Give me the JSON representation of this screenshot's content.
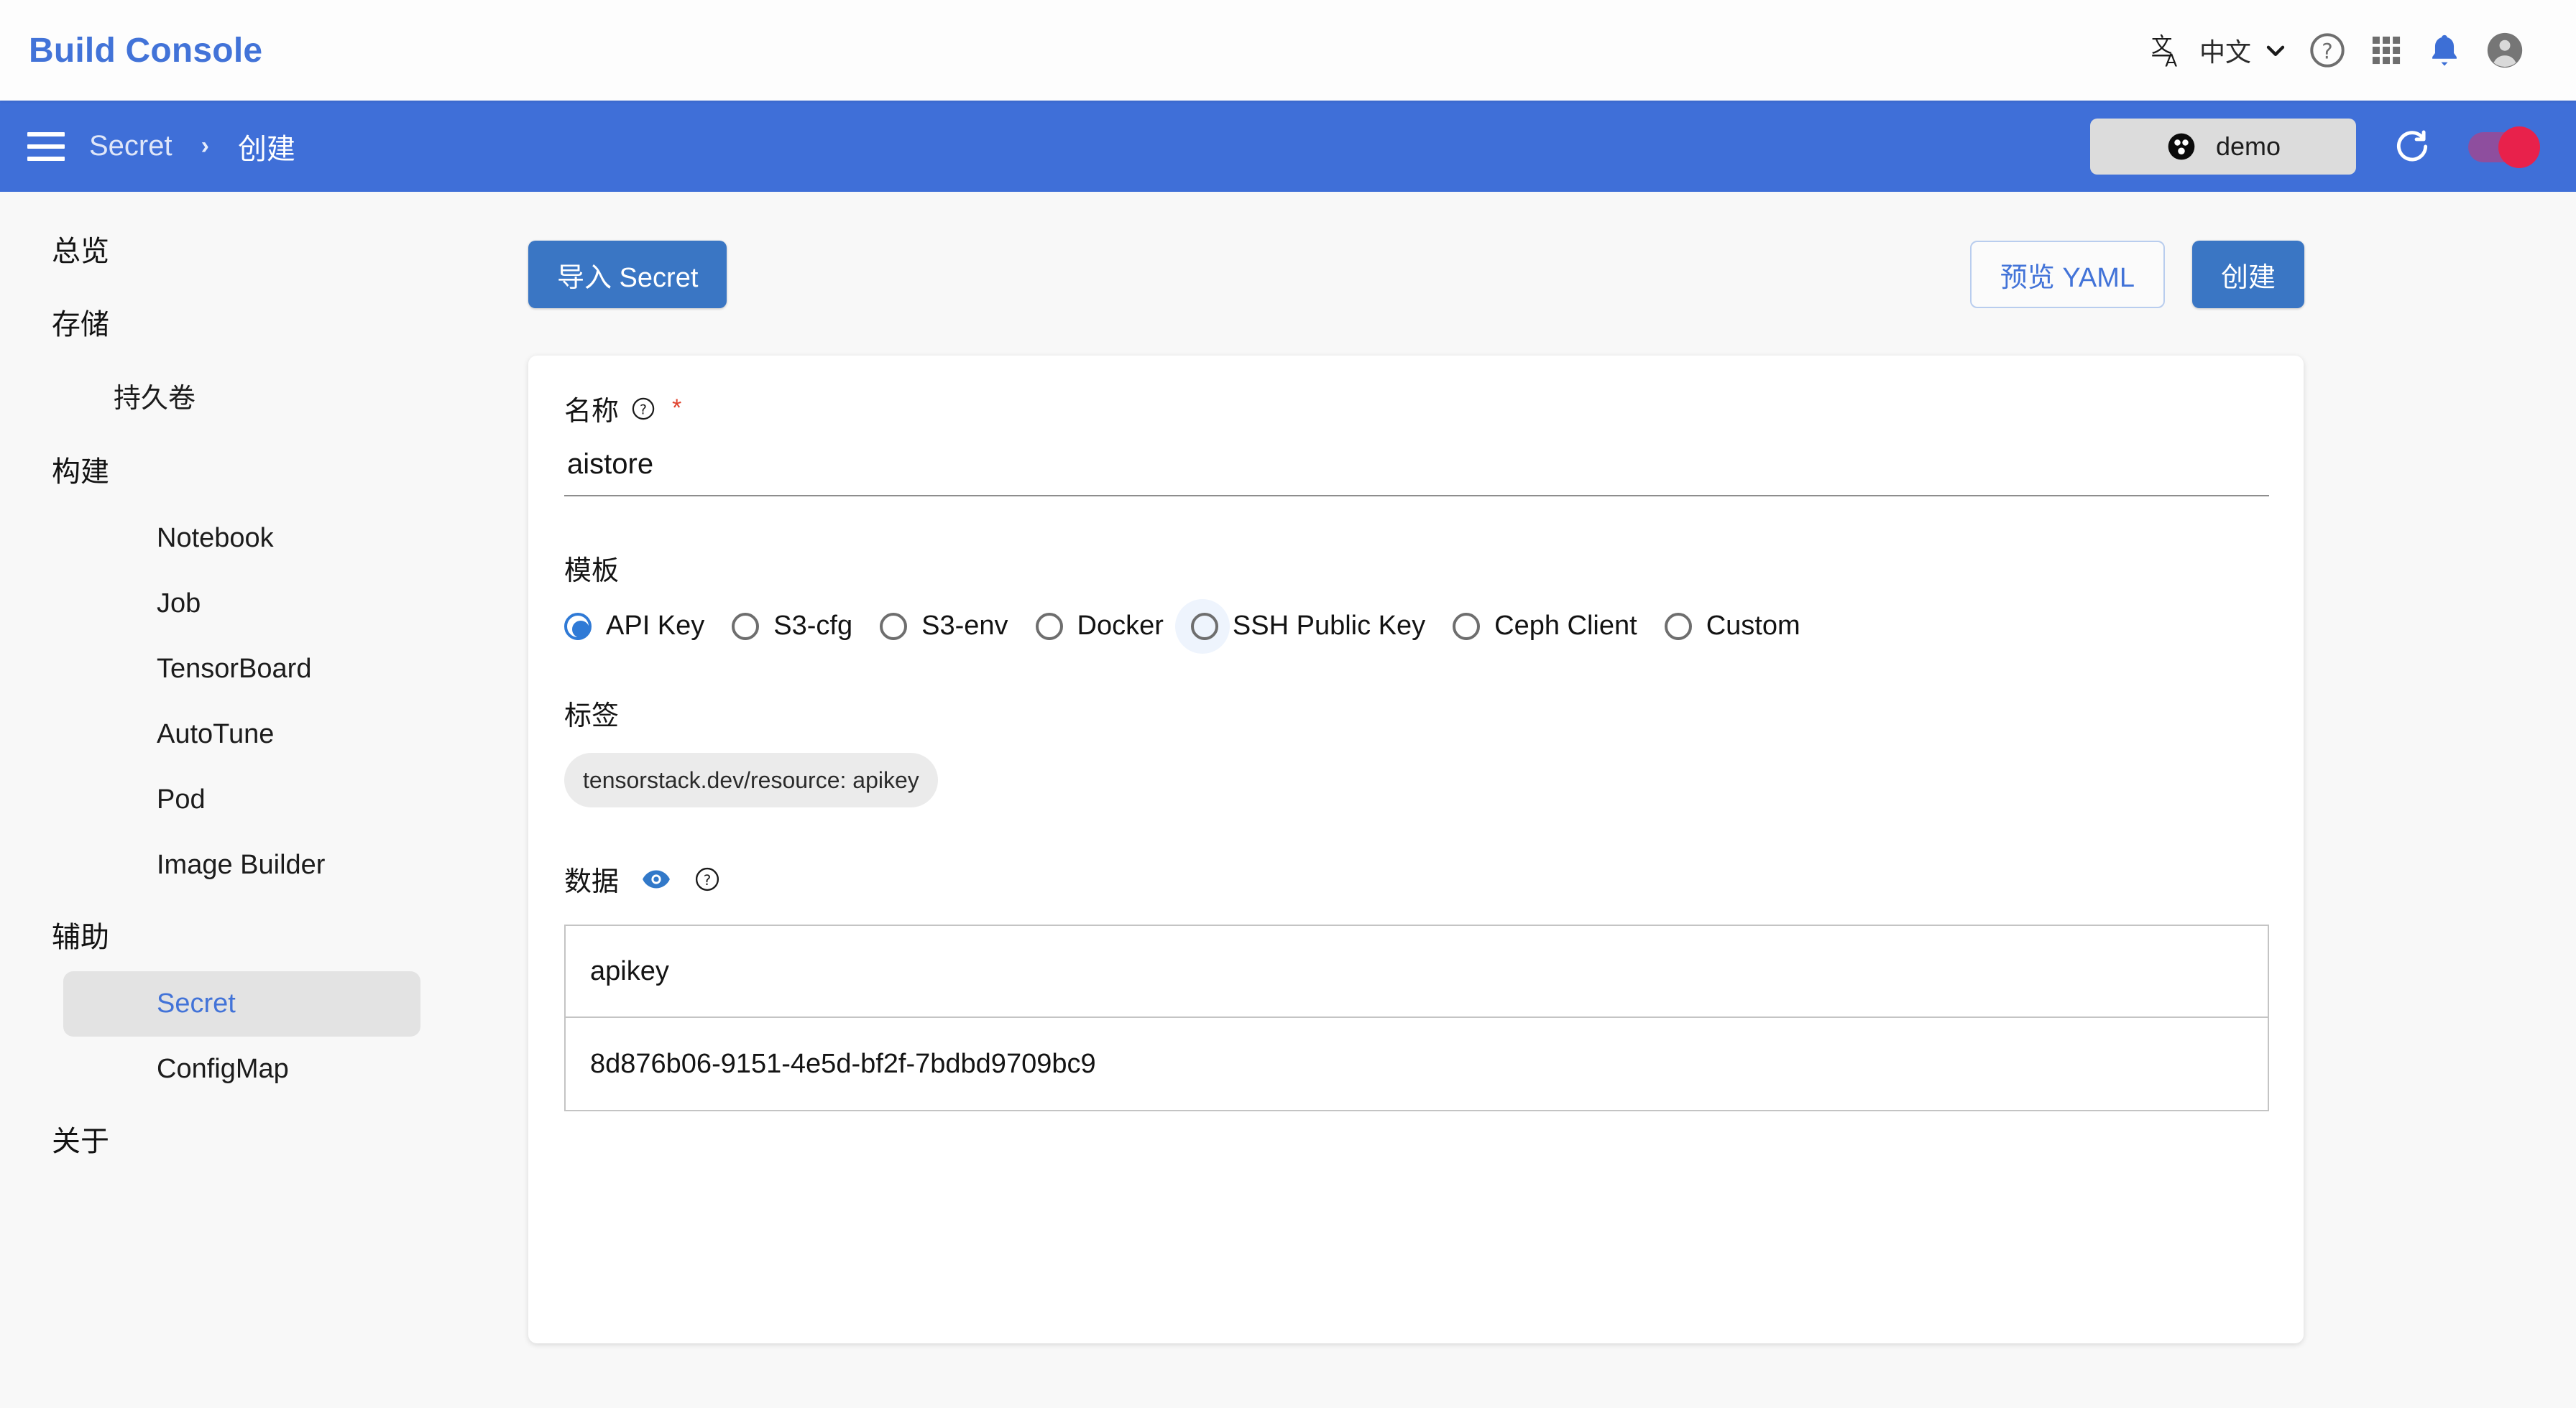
{
  "topbar": {
    "brand": "Build Console",
    "language": "中文",
    "icons": {
      "translate": "translate-icon",
      "chevron": "chevron-down-icon",
      "help": "help-circle-icon",
      "apps": "apps-grid-icon",
      "notifications": "bell-icon",
      "account": "account-circle-icon"
    }
  },
  "breadcrumbbar": {
    "menu": "menu-icon",
    "crumb_parent": "Secret",
    "separator": "›",
    "crumb_current": "创建",
    "project_chip": "demo",
    "refresh": "refresh-icon",
    "toggle_on": true
  },
  "sidebar": {
    "items": [
      {
        "label": "总览",
        "type": "section",
        "active": false
      },
      {
        "label": "存储",
        "type": "section",
        "active": false
      },
      {
        "label": "持久卷",
        "type": "item-cjk",
        "active": false
      },
      {
        "label": "构建",
        "type": "section",
        "active": false
      },
      {
        "label": "Notebook",
        "type": "item",
        "active": false
      },
      {
        "label": "Job",
        "type": "item",
        "active": false
      },
      {
        "label": "TensorBoard",
        "type": "item",
        "active": false
      },
      {
        "label": "AutoTune",
        "type": "item",
        "active": false
      },
      {
        "label": "Pod",
        "type": "item",
        "active": false
      },
      {
        "label": "Image Builder",
        "type": "item",
        "active": false
      },
      {
        "label": "辅助",
        "type": "section",
        "active": false
      },
      {
        "label": "Secret",
        "type": "item",
        "active": true
      },
      {
        "label": "ConfigMap",
        "type": "item",
        "active": false
      },
      {
        "label": "关于",
        "type": "section",
        "active": false
      }
    ]
  },
  "actions": {
    "import_label": "导入 Secret",
    "preview_yaml_label": "预览 YAML",
    "create_label": "创建"
  },
  "form": {
    "name": {
      "label": "名称",
      "help_icon": "help-circle-icon",
      "required_mark": "*",
      "value": "aistore",
      "placeholder": "名称"
    },
    "template": {
      "label": "模板",
      "options": [
        {
          "label": "API Key",
          "selected": true,
          "hovered": false
        },
        {
          "label": "S3-cfg",
          "selected": false,
          "hovered": false
        },
        {
          "label": "S3-env",
          "selected": false,
          "hovered": false
        },
        {
          "label": "Docker",
          "selected": false,
          "hovered": false
        },
        {
          "label": "SSH Public Key",
          "selected": false,
          "hovered": true
        },
        {
          "label": "Ceph Client",
          "selected": false,
          "hovered": false
        },
        {
          "label": "Custom",
          "selected": false,
          "hovered": false
        }
      ]
    },
    "labels": {
      "label": "标签",
      "chips": [
        "tensorstack.dev/resource: apikey"
      ]
    },
    "data": {
      "label": "数据",
      "eye_icon": "eye-icon",
      "help_icon": "help-circle-icon",
      "entries": [
        {
          "key": "apikey",
          "value": "8d876b06-9151-4e5d-bf2f-7bdbd9709bc9"
        }
      ]
    }
  },
  "colors": {
    "brand_blue": "#4273d8",
    "bar_blue": "#3f6fd8",
    "button_blue": "#3a76c4",
    "required_red": "#e0432e",
    "toggle_knob": "#e8214b",
    "toggle_track": "#8e4e9e"
  }
}
